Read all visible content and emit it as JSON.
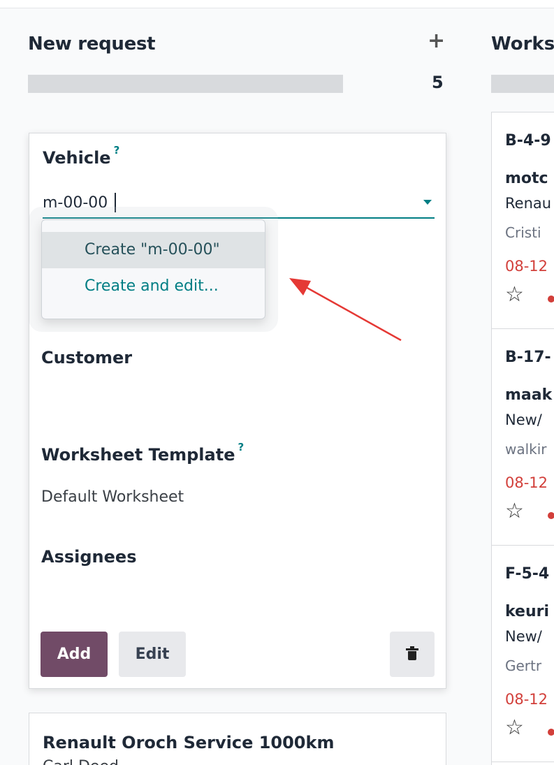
{
  "column_new": {
    "title": "New request",
    "add_icon": "plus-icon",
    "count": "5"
  },
  "quick_create": {
    "vehicle_label": "Vehicle",
    "vehicle_help": "?",
    "vehicle_value": "m-00-00",
    "dropdown": {
      "create_label": "Create \"m-00-00\"",
      "create_edit_label": "Create and edit..."
    },
    "customer_label": "Customer",
    "worksheet_label": "Worksheet Template",
    "worksheet_help": "?",
    "worksheet_value": "Default Worksheet",
    "assignees_label": "Assignees",
    "add_button": "Add",
    "edit_button": "Edit",
    "delete_icon": "trash-icon"
  },
  "next_card": {
    "title": "Renault Oroch Service 1000km",
    "subtitle": "Carl Deed..."
  },
  "column_work": {
    "title": "Works",
    "cards": [
      {
        "ref": "B-4-9",
        "name": "motc",
        "line3": "Renau",
        "line4": "Cristi",
        "date": "08-12"
      },
      {
        "ref": "B-17-",
        "name": "maak",
        "line3": "New/",
        "line4": "walkir",
        "date": "08-12"
      },
      {
        "ref": "F-5-4",
        "name": "keuri",
        "line3": "New/",
        "line4": "Gertr",
        "date": "08-12"
      }
    ]
  },
  "colors": {
    "accent": "#017e84",
    "primary": "#714b67",
    "danger": "#d23f3a",
    "annotation_arrow": "#e53935"
  }
}
